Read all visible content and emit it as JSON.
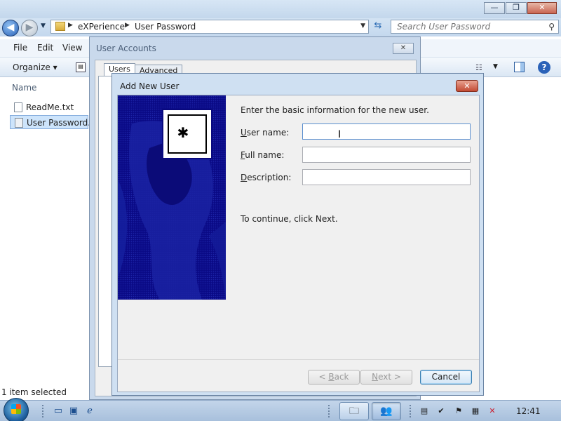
{
  "explorer": {
    "window_controls": {
      "minimize": "—",
      "maximize": "❐",
      "close": "✕"
    },
    "breadcrumbs": [
      "eXPerience",
      "User Password"
    ],
    "search_placeholder": "Search User Password",
    "menu": [
      "File",
      "Edit",
      "View"
    ],
    "toolbar": {
      "organize": "Organize"
    },
    "column_header": "Name",
    "files": [
      {
        "name": "ReadMe.txt",
        "selected": false
      },
      {
        "name": "User Password.b",
        "selected": true
      }
    ],
    "status": "1 item selected"
  },
  "user_accounts": {
    "title": "User Accounts",
    "close_glyph": "✕",
    "tabs": [
      "Users",
      "Advanced"
    ]
  },
  "add_user_dialog": {
    "title": "Add New User",
    "close_glyph": "✕",
    "key_glyph": "✱",
    "intro": "Enter the basic information for the new user.",
    "fields": [
      {
        "label": "User name:",
        "accel": "U",
        "rest": "ser name:",
        "value": ""
      },
      {
        "label": "Full name:",
        "accel": "F",
        "rest": "ull name:",
        "value": ""
      },
      {
        "label": "Description:",
        "accel": "D",
        "rest": "escription:",
        "value": ""
      }
    ],
    "continue_text": "To continue, click Next.",
    "buttons": {
      "back": {
        "prefix": "< ",
        "accel": "B",
        "rest": "ack"
      },
      "next": {
        "accel": "N",
        "rest": "ext >"
      },
      "cancel": "Cancel"
    }
  },
  "taskbar": {
    "clock": "12:41"
  },
  "colors": {
    "dialog_side_panel": "#09097e",
    "selection": "#cde4fb",
    "close_red": "#c24a33"
  }
}
